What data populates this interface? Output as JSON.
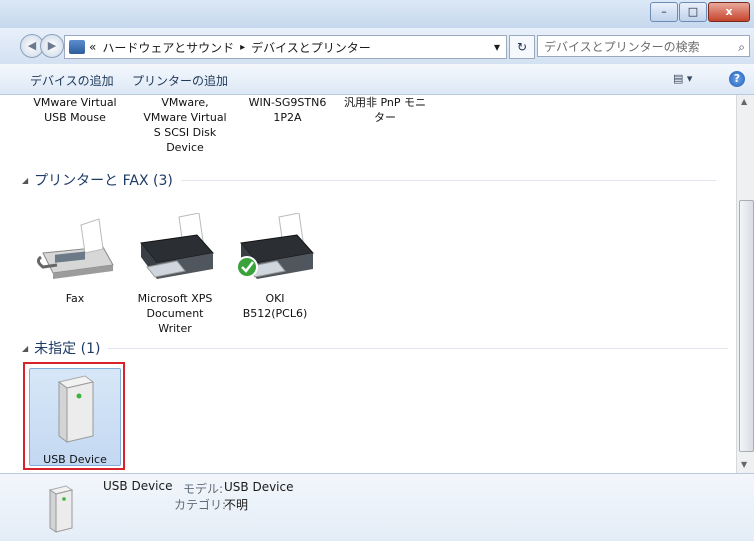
{
  "window": {
    "title": "",
    "minimize": "–",
    "maximize": "□",
    "close": "x"
  },
  "address": {
    "back_icon": "back-arrow-icon",
    "forward_icon": "forward-arrow-icon",
    "crumbs": [
      "«",
      "ハードウェアとサウンド",
      "▸",
      "デバイスとプリンター"
    ],
    "dropdown": "▾",
    "refresh": "↻",
    "search_placeholder": "デバイスとプリンターの検索",
    "search_icon": "⌕"
  },
  "toolbar": {
    "add_device": "デバイスの追加",
    "add_printer": "プリンターの追加",
    "view": "▤ ▾",
    "help": "?"
  },
  "devices_top": [
    {
      "label": [
        "VMware Virtual",
        "USB Mouse"
      ]
    },
    {
      "label": [
        "VMware,",
        "VMware Virtual",
        "S SCSI Disk",
        "Device"
      ]
    },
    {
      "label": [
        "WIN-SG9STN6",
        "1P2A"
      ]
    },
    {
      "label": [
        "汎用非 PnP モニ",
        "ター"
      ]
    }
  ],
  "groups": {
    "printers": "プリンターと FAX (3)",
    "unspecified": "未指定 (1)",
    "collapse_glyph": "◢"
  },
  "printers": [
    {
      "label": [
        "Fax"
      ]
    },
    {
      "label": [
        "Microsoft XPS",
        "Document",
        "Writer"
      ]
    },
    {
      "label": [
        "OKI",
        "B512(PCL6)"
      ],
      "default": true
    }
  ],
  "unspecified_items": [
    {
      "label": [
        "USB Device"
      ],
      "selected": true
    }
  ],
  "details": {
    "name": "USB Device",
    "model_label": "モデル:",
    "model_value": "USB Device",
    "category_label": "カテゴリ:",
    "category_value": "不明"
  },
  "colors": {
    "selection_border": "#d9232a",
    "selection_fill": "#cfe1f6",
    "group_header": "#1e3a66"
  }
}
